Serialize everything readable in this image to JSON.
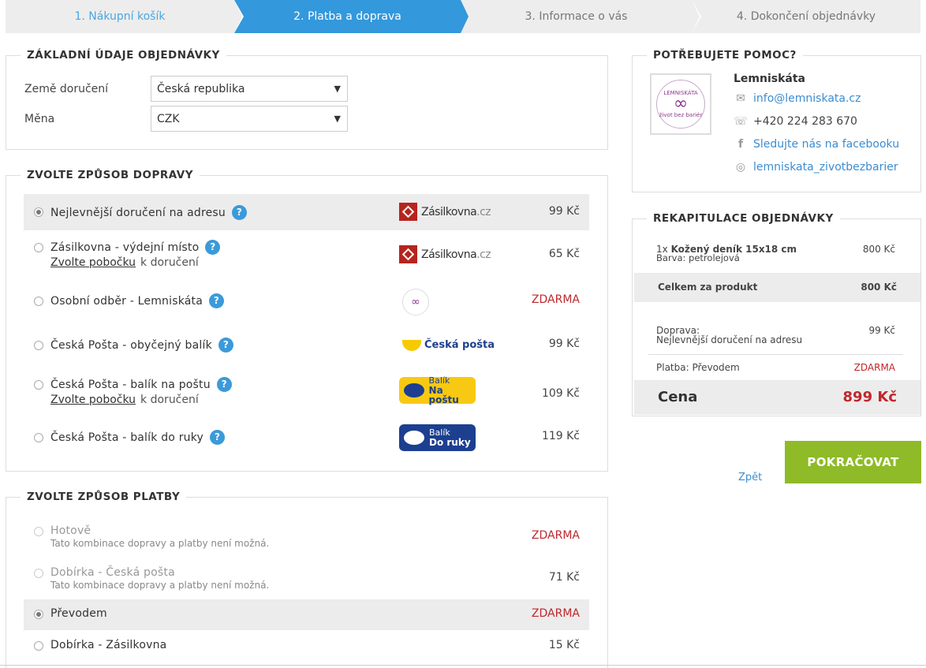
{
  "steps": [
    "1. Nákupní košík",
    "2. Platba a doprava",
    "3. Informace o vás",
    "4. Dokončení objednávky"
  ],
  "basic": {
    "legend": "ZÁKLADNÍ ÚDAJE OBJEDNÁVKY",
    "country_label": "Země doručení",
    "country_value": "Česká republika",
    "currency_label": "Měna",
    "currency_value": "CZK"
  },
  "shipping": {
    "legend": "ZVOLTE ZPŮSOB DOPRAVY",
    "branch_link": "Zvolte pobočku",
    "branch_suffix": "k doručení",
    "options": [
      {
        "name": "Nejlevnější doručení na adresu",
        "price": "99 Kč",
        "logo": "Zásilkovna"
      },
      {
        "name": "Zásilkovna - výdejní místo",
        "price": "65 Kč",
        "logo": "Zásilkovna"
      },
      {
        "name": "Osobní odběr - Lemniskáta",
        "price": "ZDARMA",
        "logo": "Lemniskáta"
      },
      {
        "name": "Česká Pošta - obyčejný balík",
        "price": "99 Kč",
        "logo": "Česká pošta"
      },
      {
        "name": "Česká Pošta - balík na poštu",
        "price": "109 Kč",
        "logo_line1": "Balík",
        "logo_line2": "Na poštu"
      },
      {
        "name": "Česká Pošta - balík do ruky",
        "price": "119 Kč",
        "logo_line1": "Balík",
        "logo_line2": "Do ruky"
      }
    ],
    "zas_brand": "Zásilkovna",
    "zas_tld": ".cz"
  },
  "payment": {
    "legend": "ZVOLTE ZPŮSOB PLATBY",
    "note": "Tato kombinace dopravy a platby není možná.",
    "options": [
      {
        "name": "Hotově",
        "price": "ZDARMA"
      },
      {
        "name": "Dobírka - Česká pošta",
        "price": "71 Kč"
      },
      {
        "name": "Převodem",
        "price": "ZDARMA"
      },
      {
        "name": "Dobírka - Zásilkovna",
        "price": "15 Kč"
      }
    ]
  },
  "help": {
    "legend": "POTŘEBUJETE POMOC?",
    "company": "Lemniskáta",
    "email": "info@lemniskata.cz",
    "phone": "+420 224 283 670",
    "facebook": "Sledujte nás na facebooku",
    "instagram": "lemniskata_zivotbezbarier",
    "logo_top": "LEMNISKÁTA",
    "logo_bottom": "život bez bariér"
  },
  "recap": {
    "legend": "REKAPITULACE OBJEDNÁVKY",
    "qty": "1x",
    "product": "Kožený deník 15x18 cm",
    "variant": "Barva: petrolejová",
    "product_price": "800 Kč",
    "total_product_label": "Celkem za produkt",
    "total_product_value": "800 Kč",
    "shipping_label": "Doprava:",
    "shipping_name": "Nejlevnější doručení na adresu",
    "shipping_price": "99 Kč",
    "payment_label": "Platba:",
    "payment_name": "Převodem",
    "payment_price": "ZDARMA",
    "total_label": "Cena",
    "total_value": "899 Kč"
  },
  "actions": {
    "back": "Zpět",
    "continue": "POKRAČOVAT"
  },
  "colors": {
    "accent": "#3398dc",
    "button": "#8ebb27",
    "price_highlight": "#c0272d"
  }
}
